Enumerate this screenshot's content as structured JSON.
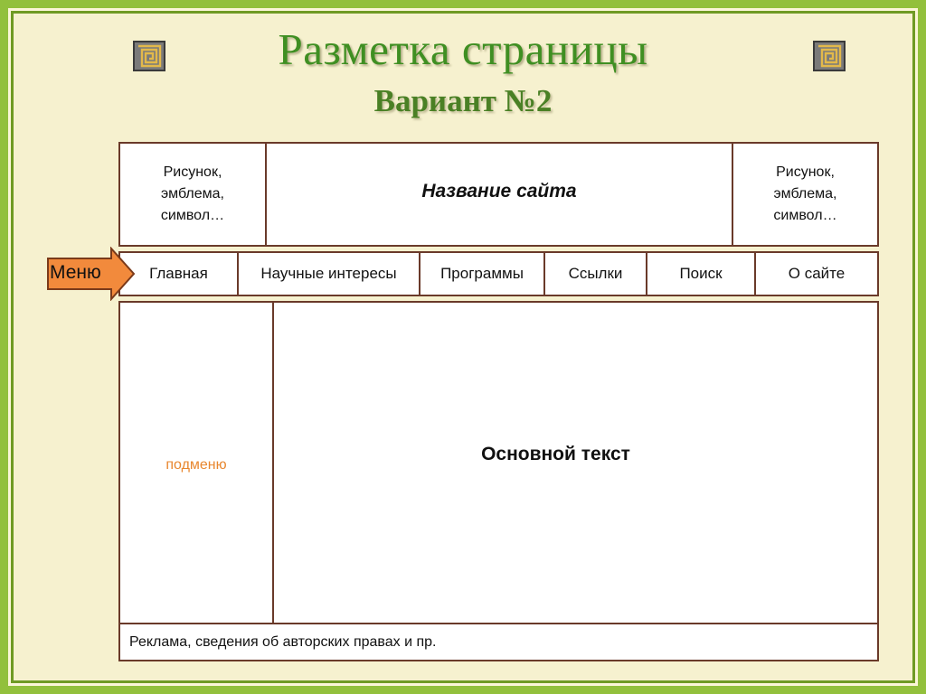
{
  "slide": {
    "title": "Разметка страницы",
    "subtitle": "Вариант №2"
  },
  "header": {
    "left_logo": [
      "Рисунок,",
      "эмблема,",
      "символ…"
    ],
    "site_name": "Название сайта",
    "right_logo": [
      "Рисунок,",
      "эмблема,",
      "символ…"
    ]
  },
  "menu_arrow_label": "Меню",
  "menu": {
    "items": [
      "Главная",
      "Научные интересы",
      "Программы",
      "Ссылки",
      "Поиск",
      "О сайте"
    ]
  },
  "body": {
    "submenu": "подменю",
    "main_text": "Основной текст"
  },
  "footer": "Реклама, сведения об авторских правах и пр.",
  "colors": {
    "frame_green": "#92c03c",
    "title_green": "#3f8f22",
    "arrow_orange": "#f28a3c",
    "submenu_orange": "#e8872f",
    "border_brown": "#6a3a2a"
  }
}
